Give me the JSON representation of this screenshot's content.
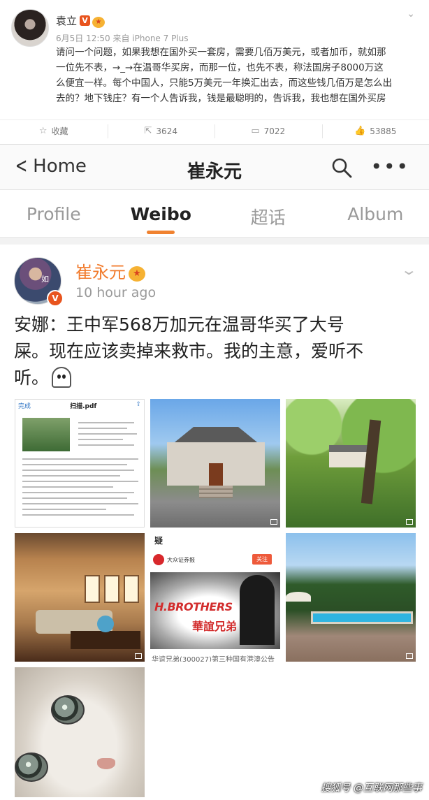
{
  "top_post": {
    "author": "袁立",
    "meta": "6月5日 12:50 来自 iPhone 7 Plus",
    "lines": [
      "请问一个问题，如果我想在国外买一套房，需要几佰万美元，或者加币，就如那",
      "一位先不表，→_→在温哥华买房，而那一位，也先不表，称法国房子8000万这",
      "么便宜一样。每个中国人，只能5万美元一年换汇出去，而这些钱几佰万是怎么出",
      "去的？地下钱庄？有一个人告诉我，钱是最聪明的，告诉我，我也想在国外买房"
    ],
    "actions": {
      "favorite": "收藏",
      "repost_count": "3624",
      "comment_count": "7022",
      "like_count": "53885"
    }
  },
  "nav": {
    "back_label": "Home",
    "title": "崔永元"
  },
  "tabs": [
    "Profile",
    "Weibo",
    "超话",
    "Album"
  ],
  "post": {
    "author": "崔永元",
    "time": "10 hour ago",
    "lines": [
      "安娜：王中军568万加元在温哥华买了大号",
      "屎。现在应该卖掉来救市。我的主意，爱听不",
      "听。"
    ],
    "doc": {
      "done": "完成",
      "file": "扫描.pdf"
    },
    "news": {
      "question": "疑",
      "source": "大众证券报",
      "follow": "关注",
      "brand": "H.BROTHERS",
      "brand_cn": "華誼兄弟",
      "caption": "华谊兄弟(300027)第三种国有港澳公告"
    },
    "avatar_text": "如"
  },
  "watermark": "搜狐号 @互联网那些事",
  "colors": {
    "accent_orange": "#f08230",
    "author_orange": "#f17a2b",
    "verified": "#e8541e"
  }
}
